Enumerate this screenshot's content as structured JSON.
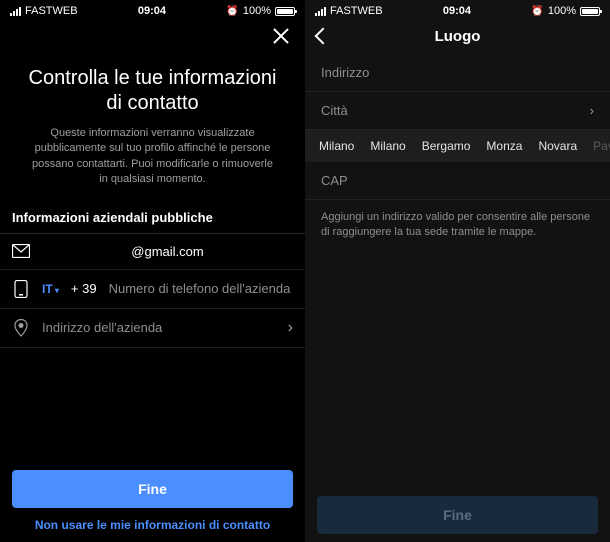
{
  "status": {
    "carrier": "FASTWEB",
    "time": "09:04",
    "battery_pct": "100%"
  },
  "left": {
    "headline": "Controlla le tue informazioni di contatto",
    "subhead": "Queste informazioni verranno visualizzate pubblicamente sul tuo profilo affinché le persone possano contattarti. Puoi modificarle o rimuoverle in qualsiasi momento.",
    "section_label": "Informazioni aziendali pubbliche",
    "email_value": "@gmail.com",
    "country_code_label": "IT",
    "dial_prefix": "+ 39",
    "phone_placeholder": "Numero di telefono dell'azienda",
    "address_placeholder": "Indirizzo dell'azienda",
    "primary_btn": "Fine",
    "secondary_link": "Non usare le mie informazioni di contatto"
  },
  "right": {
    "nav_title": "Luogo",
    "row_address": "Indirizzo",
    "row_city": "Città",
    "city_suggestions": {
      "c0": "Milano",
      "c1": "Milano",
      "c2": "Bergamo",
      "c3": "Monza",
      "c4": "Novara",
      "c5": "Pav"
    },
    "row_cap": "CAP",
    "hint": "Aggiungi un indirizzo valido per consentire alle persone di raggiungere la tua sede tramite le mappe.",
    "primary_btn": "Fine"
  }
}
